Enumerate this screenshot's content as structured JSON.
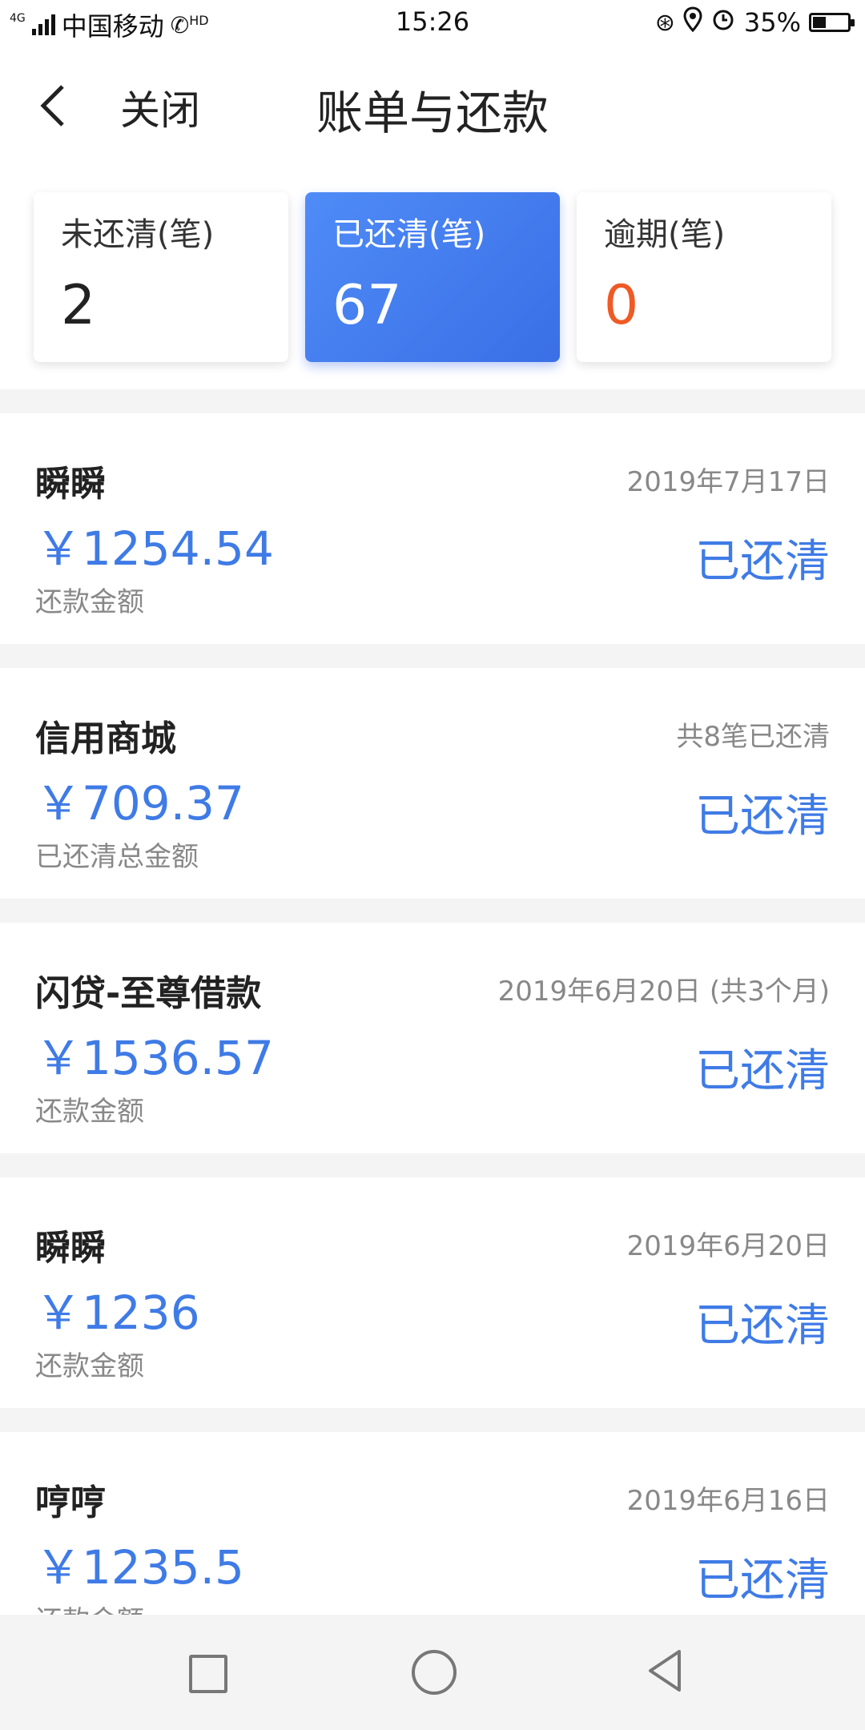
{
  "status_bar": {
    "network": "4G",
    "carrier": "中国移动",
    "hd": "HD",
    "time": "15:26",
    "battery": "35%"
  },
  "nav": {
    "close_label": "关闭",
    "title": "账单与还款"
  },
  "summary": [
    {
      "label": "未还清(笔)",
      "value": "2"
    },
    {
      "label": "已还清(笔)",
      "value": "67"
    },
    {
      "label": "逾期(笔)",
      "value": "0"
    }
  ],
  "bills": [
    {
      "name": "瞬瞬",
      "amount": "￥1254.54",
      "sub": "还款金额",
      "date": "2019年7月17日",
      "status": "已还清"
    },
    {
      "name": "信用商城",
      "amount": "￥709.37",
      "sub": "已还清总金额",
      "date": "共8笔已还清",
      "status": "已还清"
    },
    {
      "name": "闪贷-至尊借款",
      "amount": "￥1536.57",
      "sub": "还款金额",
      "date": "2019年6月20日 (共3个月)",
      "status": "已还清"
    },
    {
      "name": "瞬瞬",
      "amount": "￥1236",
      "sub": "还款金额",
      "date": "2019年6月20日",
      "status": "已还清"
    },
    {
      "name": "哼哼",
      "amount": "￥1235.5",
      "sub": "还款金额",
      "date": "2019年6月16日",
      "status": "已还清"
    }
  ],
  "colors": {
    "accent": "#3f7be6",
    "overdue": "#ef5a25"
  }
}
